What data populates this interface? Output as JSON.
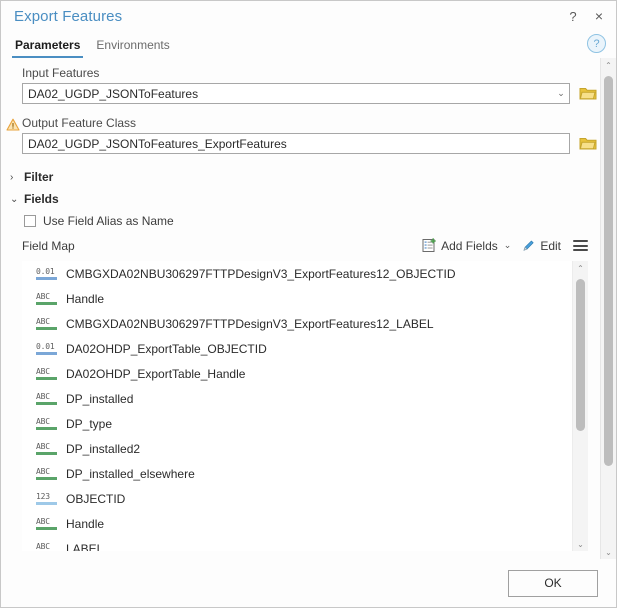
{
  "window": {
    "title": "Export Features",
    "help_button": "?",
    "close_button": "×",
    "help_circle": "?"
  },
  "tabs": [
    {
      "label": "Parameters",
      "active": true
    },
    {
      "label": "Environments",
      "active": false
    }
  ],
  "parameters": {
    "input_features": {
      "label": "Input Features",
      "value": "DA02_UGDP_JSONToFeatures",
      "chevron": "⌄",
      "browse_icon": "folder-icon"
    },
    "output_feature_class": {
      "label": "Output Feature Class",
      "value": "DA02_UGDP_JSONToFeatures_ExportFeatures",
      "warning_icon": "warning-triangle-icon",
      "browse_icon": "folder-icon"
    }
  },
  "sections": {
    "filter": {
      "label": "Filter",
      "expanded": false,
      "arrow": "›"
    },
    "fields": {
      "label": "Fields",
      "expanded": true,
      "arrow": "⌄"
    }
  },
  "use_field_alias": {
    "label": "Use Field Alias as Name",
    "checked": false
  },
  "field_map": {
    "title": "Field Map",
    "add_fields_label": "Add Fields",
    "add_fields_chevron": "⌄",
    "edit_label": "Edit",
    "menu_icon": "hamburger-menu-icon",
    "rows": [
      {
        "type": "double",
        "glyph": "0.01",
        "name": "CMBGXDA02NBU306297FTTPDesignV3_ExportFeatures12_OBJECTID"
      },
      {
        "type": "text",
        "glyph": "ABC",
        "name": "Handle"
      },
      {
        "type": "text",
        "glyph": "ABC",
        "name": "CMBGXDA02NBU306297FTTPDesignV3_ExportFeatures12_LABEL"
      },
      {
        "type": "double",
        "glyph": "0.01",
        "name": "DA02OHDP_ExportTable_OBJECTID"
      },
      {
        "type": "text",
        "glyph": "ABC",
        "name": "DA02OHDP_ExportTable_Handle"
      },
      {
        "type": "text",
        "glyph": "ABC",
        "name": "DP_installed"
      },
      {
        "type": "text",
        "glyph": "ABC",
        "name": "DP_type"
      },
      {
        "type": "text",
        "glyph": "ABC",
        "name": "DP_installed2"
      },
      {
        "type": "text",
        "glyph": "ABC",
        "name": "DP_installed_elsewhere"
      },
      {
        "type": "oid",
        "glyph": "123",
        "name": "OBJECTID"
      },
      {
        "type": "text",
        "glyph": "ABC",
        "name": "Handle"
      },
      {
        "type": "text",
        "glyph": "ABC",
        "name": "LABEL"
      }
    ]
  },
  "scrollbars": {
    "list": {
      "up_arrow": "⌃",
      "down_arrow": "⌄"
    },
    "dialog": {
      "up_arrow": "⌃",
      "down_arrow": "⌄"
    }
  },
  "footer": {
    "ok_label": "OK"
  },
  "colors": {
    "title": "#4a8ec2",
    "tab_accent": "#4a8ec2",
    "text_field_bar": "#5aa469",
    "double_field_bar": "#7ba7d7",
    "oid_field_bar": "#9ec9e8",
    "folder": "#e8c33c",
    "warning": "#e8a33d"
  }
}
